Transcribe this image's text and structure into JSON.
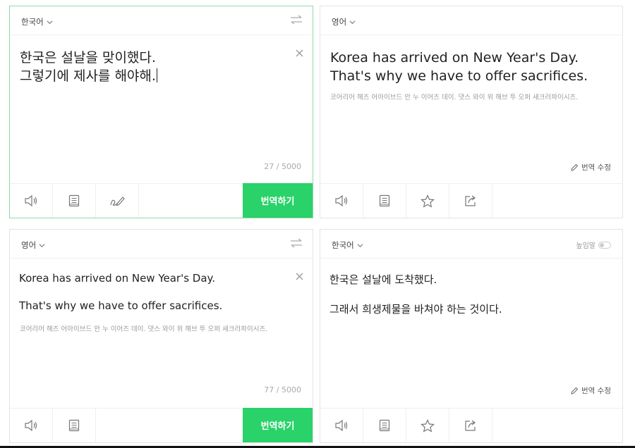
{
  "top": {
    "source": {
      "language": "한국어",
      "lines": [
        "한국은 설날을 맞이했다.",
        "그렇기에 제사를 해야해."
      ],
      "char_count": "27 / 5000",
      "translate_label": "번역하기"
    },
    "result": {
      "language": "영어",
      "lines": [
        "Korea has arrived on New Year's Day.",
        "That's why we have to offer sacrifices."
      ],
      "pronunciation": "코어리어 해즈 어아이브드 안 누 이어즈 데이. 댓스 와이 위 해브 투 오퍼 새크러파이시즈.",
      "edit_label": "번역 수정"
    }
  },
  "bottom": {
    "source": {
      "language": "영어",
      "lines": [
        "Korea has arrived on New Year's Day.",
        "That's why we have to offer sacrifices."
      ],
      "pronunciation": "코어리어 해즈 어아이브드 안 누 이어즈 데이. 댓스 와이 위 해브 투 오퍼 새크러파이시즈.",
      "char_count": "77 / 5000",
      "translate_label": "번역하기"
    },
    "result": {
      "language": "한국어",
      "honorific_label": "높임말",
      "lines": [
        "한국은 설날에 도착했다.",
        "그래서 희생제물을 바쳐야 하는 것이다."
      ],
      "edit_label": "번역 수정"
    }
  },
  "icons": {
    "speaker": "speaker-icon",
    "dictionary": "dictionary-icon",
    "handwriting": "handwriting-icon",
    "star": "star-icon",
    "share": "share-icon",
    "swap": "swap-icon",
    "close": "close-icon",
    "pencil": "pencil-icon",
    "chevron": "chevron-down-icon"
  },
  "colors": {
    "accent": "#2ad26a",
    "active_border": "#8fd9a8"
  }
}
